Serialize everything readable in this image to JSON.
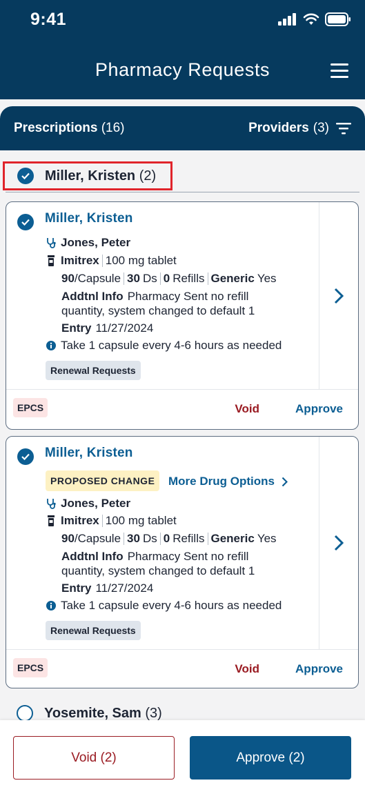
{
  "status": {
    "time": "9:41"
  },
  "header": {
    "title": "Pharmacy Requests"
  },
  "tabs": {
    "prescriptions_label": "Prescriptions",
    "prescriptions_count": "(16)",
    "providers_label": "Providers",
    "providers_count": "(3)"
  },
  "group": {
    "name": "Miller, Kristen",
    "count": "(2)"
  },
  "cards": [
    {
      "patient": "Miller, Kristen",
      "provider": "Jones, Peter",
      "drug": "Imitrex",
      "strength": "100 mg tablet",
      "qty": "90",
      "unit": "/Capsule",
      "days": "30",
      "days_unit": "Ds",
      "refills": "0",
      "refills_label": "Refills",
      "generic_label": "Generic",
      "generic_value": "Yes",
      "addtl_label": "Addtnl Info",
      "addtl_text_1": "Pharmacy Sent no refill",
      "addtl_text_2": "quantity, system changed to default 1",
      "entry_label": "Entry",
      "entry_date": "11/27/2024",
      "sig": "Take 1 capsule every 4-6 hours as needed",
      "chip": "Renewal Requests",
      "epcs": "EPCS",
      "void": "Void",
      "approve": "Approve"
    },
    {
      "patient": "Miller, Kristen",
      "proposed": "PROPOSED CHANGE",
      "more_options": "More Drug Options",
      "provider": "Jones, Peter",
      "drug": "Imitrex",
      "strength": "100 mg tablet",
      "qty": "90",
      "unit": "/Capsule",
      "days": "30",
      "days_unit": "Ds",
      "refills": "0",
      "refills_label": "Refills",
      "generic_label": "Generic",
      "generic_value": "Yes",
      "addtl_label": "Addtnl Info",
      "addtl_text_1": "Pharmacy Sent no refill",
      "addtl_text_2": "quantity, system changed to default 1",
      "entry_label": "Entry",
      "entry_date": "11/27/2024",
      "sig": "Take 1 capsule every 4-6 hours as needed",
      "chip": "Renewal Requests",
      "epcs": "EPCS",
      "void": "Void",
      "approve": "Approve"
    }
  ],
  "next_group": {
    "name": "Yosemite, Sam",
    "count": "(3)"
  },
  "footer": {
    "void_label": "Void (2)",
    "approve_label": "Approve (2)"
  },
  "colors": {
    "primary": "#063a5e",
    "accent": "#0c5e93",
    "danger": "#9a1b22",
    "highlight": "#e0242b"
  },
  "icons": [
    "signal-icon",
    "wifi-icon",
    "battery-icon",
    "menu-icon",
    "filter-icon",
    "checkmark-icon",
    "stethoscope-icon",
    "pill-bottle-icon",
    "info-icon",
    "chevron-right-icon"
  ]
}
